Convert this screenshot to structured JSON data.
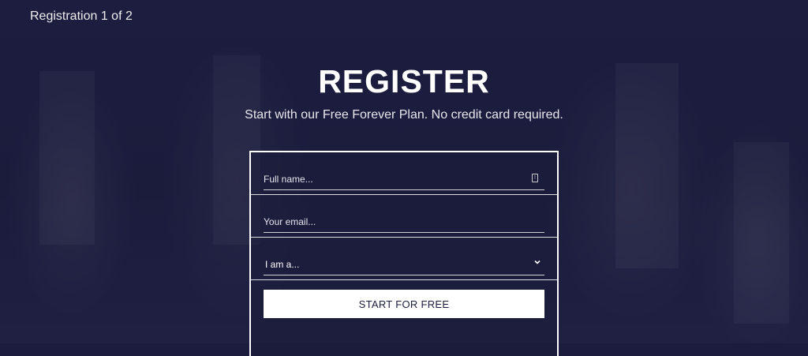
{
  "header": {
    "step_label": "Registration 1 of 2"
  },
  "hero": {
    "title": "REGISTER",
    "subtitle": "Start with our Free Forever Plan. No credit card required."
  },
  "form": {
    "full_name": {
      "placeholder": "Full name...",
      "value": ""
    },
    "email": {
      "placeholder": "Your email...",
      "value": ""
    },
    "role_select": {
      "selected": "I am a..."
    },
    "submit_label": "START FOR FREE"
  },
  "colors": {
    "background": "#1c1c3e",
    "text": "#ffffff",
    "button_background": "#ffffff",
    "button_text": "#1d1d3f"
  },
  "icons": {
    "name_field_icon": "contact-card-icon",
    "select_icon": "chevron-down-icon"
  }
}
